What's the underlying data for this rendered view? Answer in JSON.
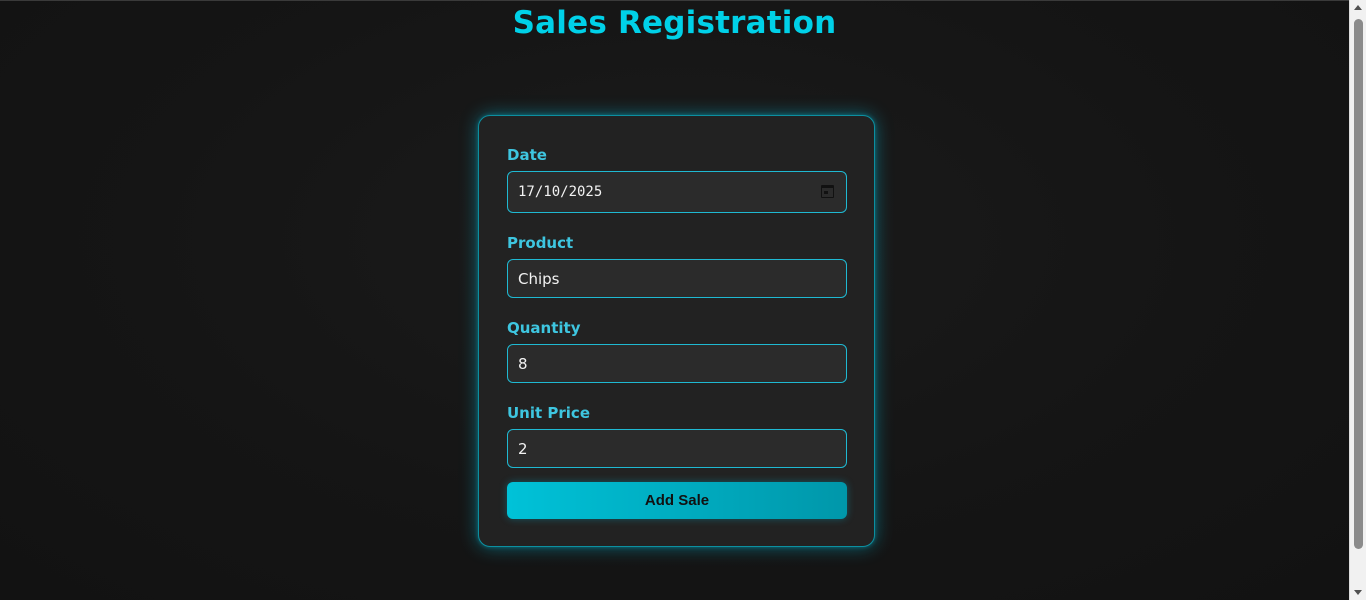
{
  "header": {
    "title": "Sales Registration"
  },
  "form": {
    "date": {
      "label": "Date",
      "value": "17/10/2025"
    },
    "product": {
      "label": "Product",
      "value": "Chips"
    },
    "quantity": {
      "label": "Quantity",
      "value": "8"
    },
    "unit_price": {
      "label": "Unit Price",
      "value": "2"
    },
    "submit_label": "Add Sale"
  },
  "icons": {
    "date_picker": "calendar-icon"
  },
  "colors": {
    "accent": "#00d1e8",
    "label": "#3ec6e0",
    "card_bg": "#222222",
    "page_bg": "#141414"
  }
}
